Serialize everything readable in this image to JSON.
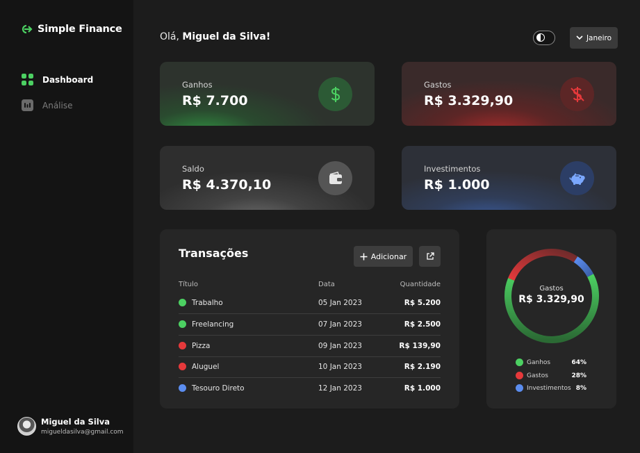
{
  "app": {
    "name": "Simple Finance"
  },
  "colors": {
    "green": "#4cd062",
    "red": "#e5393b",
    "blue": "#5b8def",
    "bg": "#1c1c1c"
  },
  "sidebar": {
    "items": [
      {
        "label": "Dashboard",
        "icon": "grid-icon",
        "active": true
      },
      {
        "label": "Análise",
        "icon": "chart-icon",
        "active": false
      }
    ],
    "user": {
      "name": "Miguel da Silva",
      "email": "migueldasilva@gmail.com"
    }
  },
  "header": {
    "greeting_prefix": "Olá, ",
    "greeting_name": "Miguel da Silva!",
    "month": "Janeiro"
  },
  "cards": {
    "ganhos": {
      "label": "Ganhos",
      "value": "R$ 7.700",
      "icon": "dollar-icon"
    },
    "gastos": {
      "label": "Gastos",
      "value": "R$ 3.329,90",
      "icon": "dollar-off-icon"
    },
    "saldo": {
      "label": "Saldo",
      "value": "R$ 4.370,10",
      "icon": "wallet-icon"
    },
    "investimentos": {
      "label": "Investimentos",
      "value": "R$ 1.000",
      "icon": "piggy-bank-icon"
    }
  },
  "transactions": {
    "title": "Transações",
    "add_label": "Adicionar",
    "columns": {
      "title": "Título",
      "date": "Data",
      "quantity": "Quantidade"
    },
    "rows": [
      {
        "title": "Trabalho",
        "date": "05 Jan 2023",
        "quantity": "R$ 5.200",
        "category": "green"
      },
      {
        "title": "Freelancing",
        "date": "07 Jan 2023",
        "quantity": "R$ 2.500",
        "category": "green"
      },
      {
        "title": "Pizza",
        "date": "09 Jan 2023",
        "quantity": "R$ 139,90",
        "category": "red"
      },
      {
        "title": "Aluguel",
        "date": "10 Jan 2023",
        "quantity": "R$ 2.190",
        "category": "red"
      },
      {
        "title": "Tesouro Direto",
        "date": "12 Jan 2023",
        "quantity": "R$ 1.000",
        "category": "blue"
      }
    ]
  },
  "donut": {
    "center_label": "Gastos",
    "center_value": "R$ 3.329,90"
  },
  "chart_data": {
    "type": "pie",
    "categories": [
      "Ganhos",
      "Gastos",
      "Investimentos"
    ],
    "values": [
      64,
      28,
      8
    ],
    "labels": [
      "64%",
      "28%",
      "8%"
    ],
    "colors": [
      "#4cd062",
      "#e5393b",
      "#5b8def"
    ]
  }
}
